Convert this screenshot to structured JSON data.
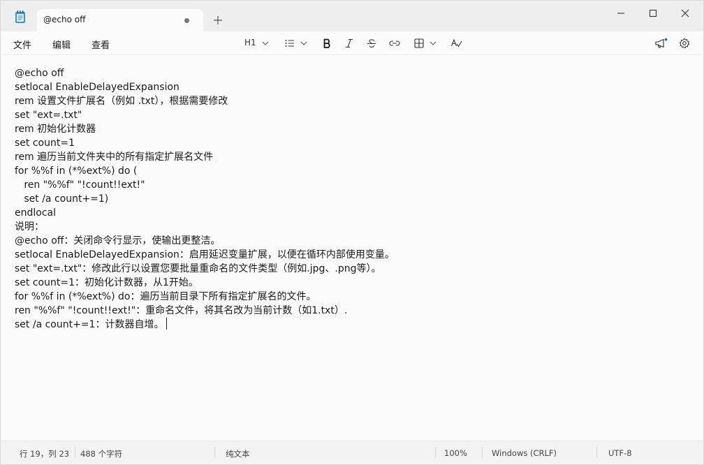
{
  "tab": {
    "title": "@echo off"
  },
  "menu": {
    "file": "文件",
    "edit": "编辑",
    "view": "查看"
  },
  "toolbar": {
    "heading": "H1",
    "icons": [
      "chevron-down-icon",
      "bulleted-list-icon",
      "bold-icon",
      "italic-icon",
      "strikethrough-icon",
      "link-icon",
      "table-icon",
      "spell-check-icon",
      "megaphone-icon",
      "gear-icon"
    ]
  },
  "editor": {
    "lines": [
      "@echo off",
      "setlocal EnableDelayedExpansion",
      "rem 设置文件扩展名（例如 .txt），根据需要修改",
      "set \"ext=.txt\"",
      "rem 初始化计数器",
      "set count=1",
      "rem 遍历当前文件夹中的所有指定扩展名文件",
      "for %%f in (*%ext%) do (",
      "   ren \"%%f\" \"!count!!ext!\"",
      "   set /a count+=1)",
      "endlocal",
      "说明：",
      "@echo off：关闭命令行显示，使输出更整洁。",
      "setlocal EnableDelayedExpansion：启用延迟变量扩展，以便在循环内部使用变量。",
      "set \"ext=.txt\"：修改此行以设置您要批量重命名的文件类型（例如.jpg、.png等）。",
      "set count=1：初始化计数器，从1开始。",
      "for %%f in (*%ext%) do：遍历当前目录下所有指定扩展名的文件。",
      "ren \"%%f\" \"!count!!ext!\"：重命名文件，将其名改为当前计数（如1.txt）.",
      "set /a count+=1：计数器自增。"
    ]
  },
  "status": {
    "position": "行 19，列 23",
    "char_count": "488 个字符",
    "format": "纯文本",
    "zoom": "100%",
    "line_ending": "Windows (CRLF)",
    "encoding": "UTF-8"
  },
  "colors": {
    "titlebar": "#eeeeee",
    "editor_bg": "#fbfbfb",
    "text": "#1a1a1a",
    "accent": "#0067c0"
  }
}
